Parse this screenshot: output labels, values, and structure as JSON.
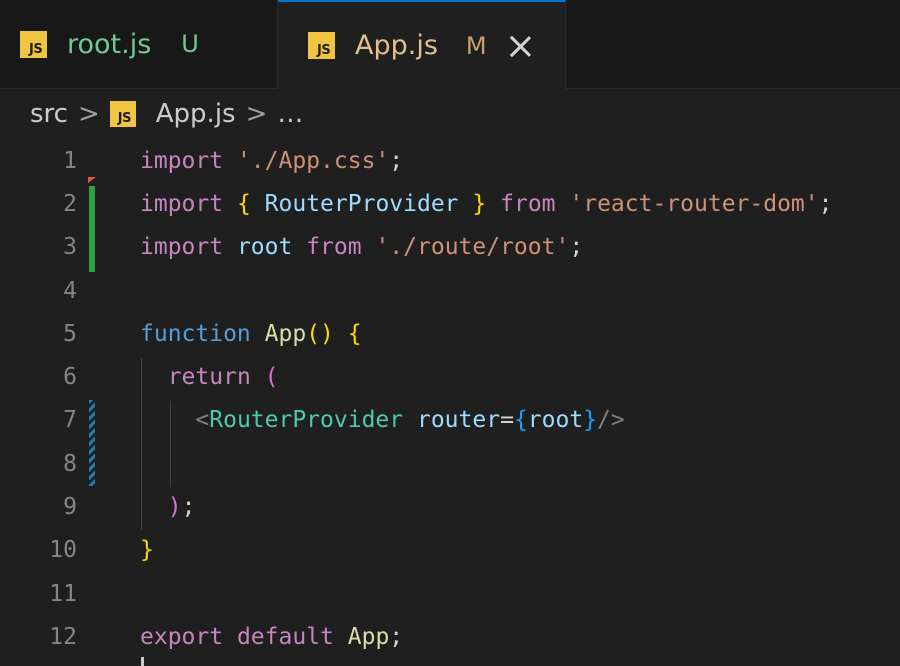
{
  "tabs": [
    {
      "label": "root.js",
      "status": "U",
      "icon": "js-file-icon",
      "icon_text": "JS",
      "active": false
    },
    {
      "label": "App.js",
      "status": "M",
      "icon": "js-file-icon",
      "icon_text": "JS",
      "active": true
    }
  ],
  "breadcrumb": {
    "folder": "src",
    "separator": ">",
    "file": "App.js",
    "more": "…",
    "icon_text": "JS"
  },
  "editor": {
    "line_numbers": [
      "1",
      "2",
      "3",
      "4",
      "5",
      "6",
      "7",
      "8",
      "9",
      "10",
      "11",
      "12"
    ],
    "lines": [
      [
        {
          "t": "import",
          "c": "kw-import"
        },
        {
          "t": " ",
          "c": "plain"
        },
        {
          "t": "'./App.css'",
          "c": "str"
        },
        {
          "t": ";",
          "c": "plain"
        }
      ],
      [
        {
          "t": "import",
          "c": "kw-import"
        },
        {
          "t": " ",
          "c": "plain"
        },
        {
          "t": "{",
          "c": "brace1"
        },
        {
          "t": " ",
          "c": "plain"
        },
        {
          "t": "RouterProvider",
          "c": "var"
        },
        {
          "t": " ",
          "c": "plain"
        },
        {
          "t": "}",
          "c": "brace1"
        },
        {
          "t": " ",
          "c": "plain"
        },
        {
          "t": "from",
          "c": "kw-import"
        },
        {
          "t": " ",
          "c": "plain"
        },
        {
          "t": "'react-router-dom'",
          "c": "str"
        },
        {
          "t": ";",
          "c": "plain"
        }
      ],
      [
        {
          "t": "import",
          "c": "kw-import"
        },
        {
          "t": " ",
          "c": "plain"
        },
        {
          "t": "root",
          "c": "var"
        },
        {
          "t": " ",
          "c": "plain"
        },
        {
          "t": "from",
          "c": "kw-import"
        },
        {
          "t": " ",
          "c": "plain"
        },
        {
          "t": "'./route/root'",
          "c": "str"
        },
        {
          "t": ";",
          "c": "plain"
        }
      ],
      [],
      [
        {
          "t": "function",
          "c": "kw-blue"
        },
        {
          "t": " ",
          "c": "plain"
        },
        {
          "t": "App",
          "c": "fn"
        },
        {
          "t": "()",
          "c": "brace1"
        },
        {
          "t": " ",
          "c": "plain"
        },
        {
          "t": "{",
          "c": "brace1"
        }
      ],
      [
        {
          "t": "  ",
          "c": "plain"
        },
        {
          "t": "return",
          "c": "kw-import"
        },
        {
          "t": " ",
          "c": "plain"
        },
        {
          "t": "(",
          "c": "brace2"
        }
      ],
      [
        {
          "t": "    ",
          "c": "plain"
        },
        {
          "t": "<",
          "c": "punct"
        },
        {
          "t": "RouterProvider",
          "c": "tag"
        },
        {
          "t": " ",
          "c": "plain"
        },
        {
          "t": "router",
          "c": "var"
        },
        {
          "t": "=",
          "c": "plain"
        },
        {
          "t": "{",
          "c": "brace3"
        },
        {
          "t": "root",
          "c": "var"
        },
        {
          "t": "}",
          "c": "brace3"
        },
        {
          "t": "/>",
          "c": "punct"
        }
      ],
      [],
      [
        {
          "t": "  ",
          "c": "plain"
        },
        {
          "t": ")",
          "c": "brace2"
        },
        {
          "t": ";",
          "c": "plain"
        }
      ],
      [
        {
          "t": "}",
          "c": "brace1"
        }
      ],
      [],
      [
        {
          "t": "export",
          "c": "kw-import"
        },
        {
          "t": " ",
          "c": "plain"
        },
        {
          "t": "default",
          "c": "kw-import"
        },
        {
          "t": " ",
          "c": "plain"
        },
        {
          "t": "App",
          "c": "fn"
        },
        {
          "t": ";",
          "c": "plain"
        }
      ]
    ]
  },
  "colors": {
    "background": "#1f1f1f",
    "accent": "#0078d4",
    "git_added": "#2ea043",
    "git_modified": "#1b81a8",
    "git_deleted": "#e5534b"
  }
}
